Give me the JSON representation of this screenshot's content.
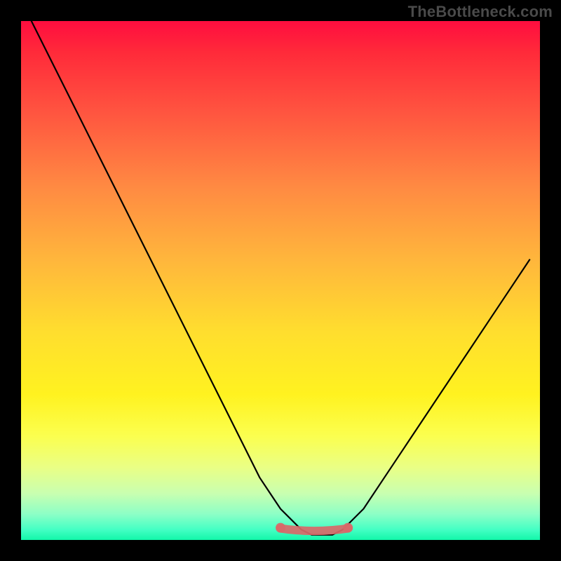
{
  "watermark": "TheBottleneck.com",
  "colors": {
    "frame": "#000000",
    "curve": "#000000",
    "trough": "#d96868",
    "gradient_top": "#ff0d3f",
    "gradient_mid": "#ffde2e",
    "gradient_bottom": "#12f7a9"
  },
  "chart_data": {
    "type": "line",
    "title": "",
    "xlabel": "",
    "ylabel": "",
    "xlim": [
      0,
      100
    ],
    "ylim": [
      0,
      100
    ],
    "grid": false,
    "legend": false,
    "series": [
      {
        "name": "bottleneck-curve",
        "x": [
          2,
          6,
          10,
          14,
          18,
          22,
          26,
          30,
          34,
          38,
          42,
          46,
          50,
          54,
          56,
          58,
          60,
          62,
          66,
          70,
          74,
          78,
          82,
          86,
          90,
          94,
          98
        ],
        "values": [
          100,
          92,
          84,
          76,
          68,
          60,
          52,
          44,
          36,
          28,
          20,
          12,
          6,
          2,
          1,
          1,
          1,
          2,
          6,
          12,
          18,
          24,
          30,
          36,
          42,
          48,
          54
        ]
      }
    ],
    "annotations": [
      {
        "name": "optimal-range",
        "x_start": 50,
        "x_end": 63,
        "y": 1
      }
    ]
  }
}
